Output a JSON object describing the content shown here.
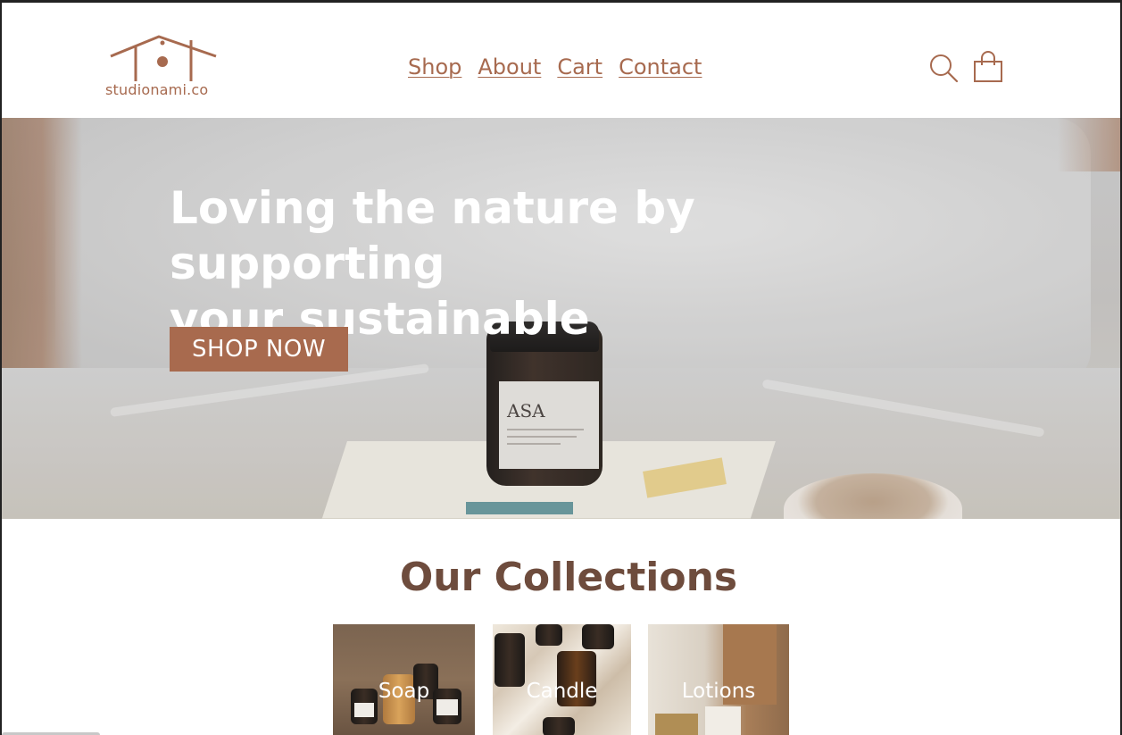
{
  "brand": {
    "name": "studionami.co",
    "color": "#a76a4f"
  },
  "nav": {
    "items": [
      "Shop",
      "About",
      "Cart",
      "Contact"
    ]
  },
  "header_icons": {
    "search": "search-icon",
    "cart": "shopping-bag-icon"
  },
  "hero": {
    "title_line1": "Loving the nature by supporting",
    "title_line2": "your sustainable",
    "cta_label": "SHOP NOW",
    "cta_color": "#a86a4e",
    "product_label": "ASA"
  },
  "collections": {
    "title": "Our Collections",
    "title_color": "#6e4c3d",
    "items": [
      {
        "label": "Soap"
      },
      {
        "label": "Candle"
      },
      {
        "label": "Lotions"
      }
    ]
  }
}
